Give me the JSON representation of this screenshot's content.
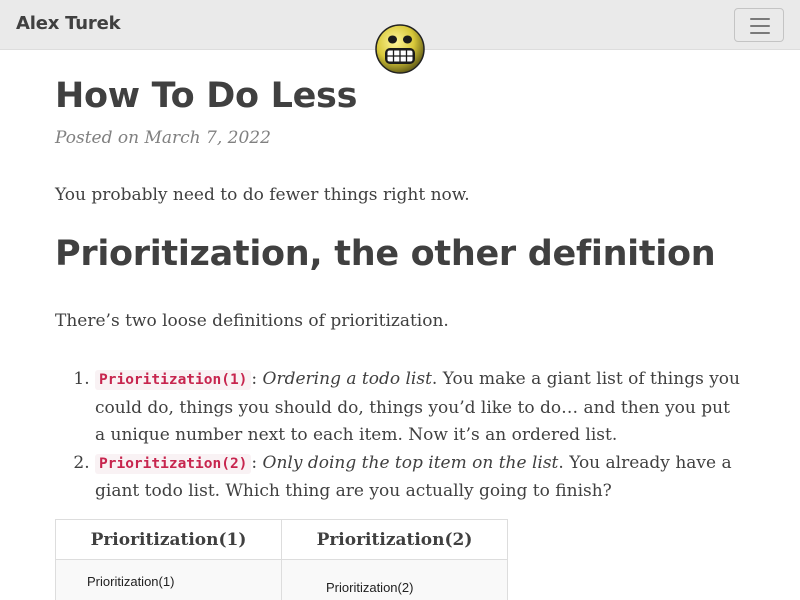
{
  "navbar": {
    "brand": "Alex Turek",
    "menu_icon": "hamburger-menu-icon"
  },
  "avatar": {
    "icon": "grinning-face-avatar"
  },
  "post": {
    "title": "How To Do Less",
    "meta": "Posted on March 7, 2022",
    "intro": "You probably need to do fewer things right now.",
    "section_heading": "Prioritization, the other definition",
    "para2": "There’s two loose definitions of prioritization.",
    "items": [
      {
        "code": "Prioritization(1)",
        "sep": ": ",
        "em": "Ordering a todo list",
        "text": ". You make a giant list of things you could do, things you should do, things you’d like to do… and then you put a unique number next to each item. Now it’s an ordered list."
      },
      {
        "code": "Prioritization(2)",
        "sep": ": ",
        "em": "Only doing the top item on the list",
        "text": ". You already have a giant todo list. Which thing are you actually going to finish?"
      }
    ]
  },
  "table": {
    "headers": [
      "Prioritization(1)",
      "Prioritization(2)"
    ],
    "image_labels": [
      "Prioritization(1)",
      "Prioritization(2)"
    ]
  },
  "colors": {
    "navbar_bg": "#eaeaea",
    "text": "#404040",
    "meta": "#808080",
    "code_text": "#c7254e",
    "code_bg": "#f9f2f4"
  }
}
